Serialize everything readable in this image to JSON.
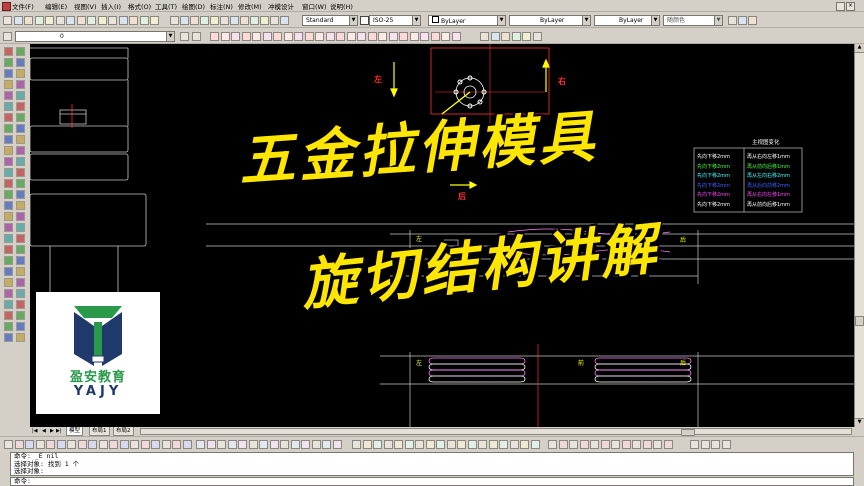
{
  "menu": [
    "文件(F)",
    "编辑(E)",
    "视图(V)",
    "插入(I)",
    "格式(O)",
    "工具(T)",
    "绘图(D)",
    "标注(N)",
    "修改(M)",
    "冲模设计",
    "窗口(W)",
    "说明(H)"
  ],
  "toolbar": {
    "text_style": "Standard",
    "dim_style": "ISO-25",
    "layer_color": "ByLayer",
    "linetype": "ByLayer",
    "lineweight": "ByLayer",
    "plot_style": "随颜色",
    "layer_name": "0"
  },
  "title_line1": "五金拉伸模具",
  "title_line2": "旋切结构讲解",
  "drawing": {
    "left": "左",
    "right": "右",
    "rear": "后",
    "front": "前",
    "back_small": "后"
  },
  "legend": {
    "header": "主视图变化",
    "left_col": [
      "先向下移2mm",
      "先向下移2mm",
      "先向下移2mm",
      "先向下移2mm",
      "先向下移2mm",
      "先向下移2mm"
    ],
    "right_col": [
      "再从右向左移1mm",
      "再从前向后移1mm",
      "再从左向右移2mm",
      "再从后向前移2mm",
      "再从右向左移1mm",
      "再从前向后移1mm"
    ]
  },
  "logo": {
    "name_cn": "盈安教育",
    "name_en": "YAJY"
  },
  "tabs": [
    "模型",
    "布局1",
    "布局2"
  ],
  "command": {
    "line1": "命令: _E nil",
    "line2": "选择对象: 找到 1 个",
    "line3": "选择对象:",
    "prompt": "命令:"
  },
  "colors": {
    "title": "#ffe600",
    "arrow": "#ffff00",
    "red_text": "#ff2020",
    "canvas": "#000000"
  }
}
